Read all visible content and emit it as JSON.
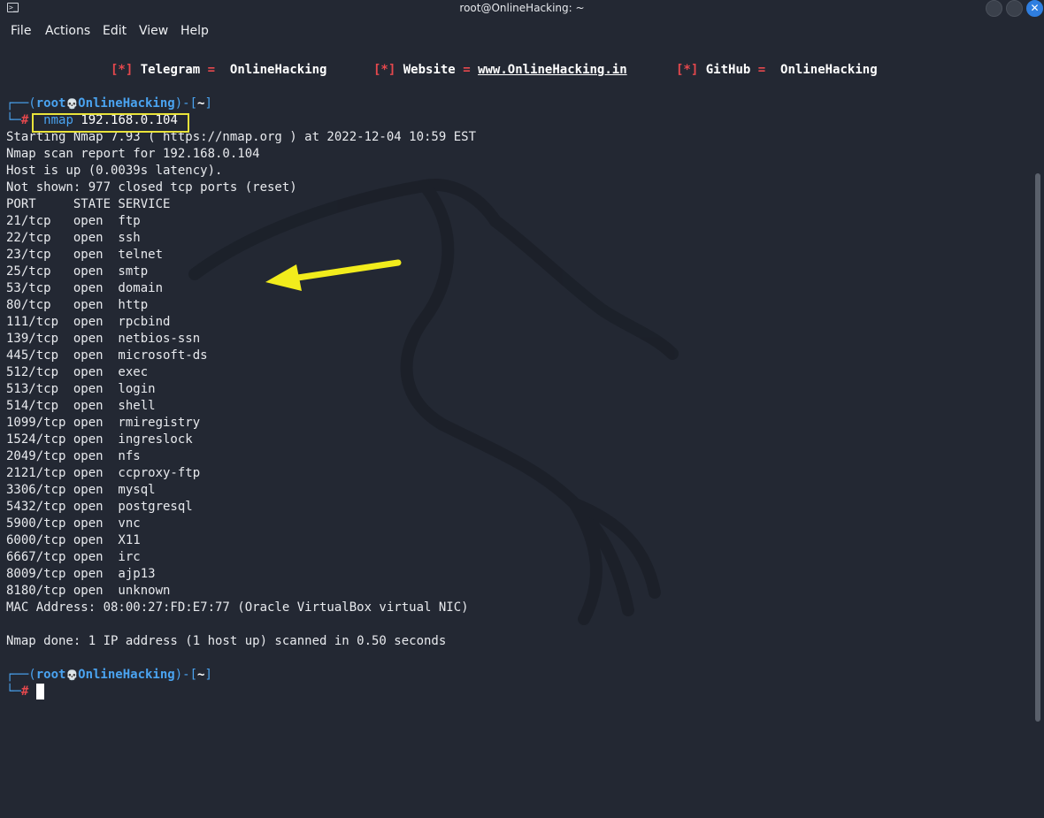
{
  "window": {
    "title": "root@OnlineHacking: ~",
    "terminal_icon": "terminal-icon",
    "close_symbol": "✕"
  },
  "menu": [
    "File",
    "Actions",
    "Edit",
    "View",
    "Help"
  ],
  "banner": {
    "telegram": {
      "bullet": "[*]",
      "label": "Telegram",
      "eq": "=",
      "value": "OnlineHacking"
    },
    "website": {
      "bullet": "[*]",
      "label": "Website",
      "eq": "=",
      "value": "www.OnlineHacking.in"
    },
    "github": {
      "bullet": "[*]",
      "label": "GitHub",
      "eq": "=",
      "value": "OnlineHacking"
    }
  },
  "prompt1": {
    "corner_top": "┌──(",
    "user": "root",
    "skull": "💀",
    "host": "OnlineHacking",
    "sep": ")-[",
    "dir": "~",
    "close": "]",
    "corner_bottom": "└─",
    "hash": "#",
    "cmd": "nmap",
    "arg": "192.168.0.104"
  },
  "output": {
    "starting": "Starting Nmap 7.93 ( https://nmap.org ) at 2022-12-04 10:59 EST",
    "report": "Nmap scan report for 192.168.0.104",
    "host_up": "Host is up (0.0039s latency).",
    "not_shown": "Not shown: 977 closed tcp ports (reset)",
    "header": "PORT     STATE SERVICE",
    "ports": [
      "21/tcp   open  ftp",
      "22/tcp   open  ssh",
      "23/tcp   open  telnet",
      "25/tcp   open  smtp",
      "53/tcp   open  domain",
      "80/tcp   open  http",
      "111/tcp  open  rpcbind",
      "139/tcp  open  netbios-ssn",
      "445/tcp  open  microsoft-ds",
      "512/tcp  open  exec",
      "513/tcp  open  login",
      "514/tcp  open  shell",
      "1099/tcp open  rmiregistry",
      "1524/tcp open  ingreslock",
      "2049/tcp open  nfs",
      "2121/tcp open  ccproxy-ftp",
      "3306/tcp open  mysql",
      "5432/tcp open  postgresql",
      "5900/tcp open  vnc",
      "6000/tcp open  X11",
      "6667/tcp open  irc",
      "8009/tcp open  ajp13",
      "8180/tcp open  unknown"
    ],
    "mac": "MAC Address: 08:00:27:FD:E7:77 (Oracle VirtualBox virtual NIC)",
    "done": "Nmap done: 1 IP address (1 host up) scanned in 0.50 seconds"
  },
  "prompt2": {
    "corner_top": "┌──(",
    "user": "root",
    "skull": "💀",
    "host": "OnlineHacking",
    "sep": ")-[",
    "dir": "~",
    "close": "]",
    "corner_bottom": "└─",
    "hash": "#"
  },
  "colors": {
    "background": "#232833",
    "prompt_blue": "#4aa3f0",
    "prompt_green": "#2ec0a0",
    "accent_red": "#e5484d",
    "highlight_yellow": "#e9e33a"
  }
}
